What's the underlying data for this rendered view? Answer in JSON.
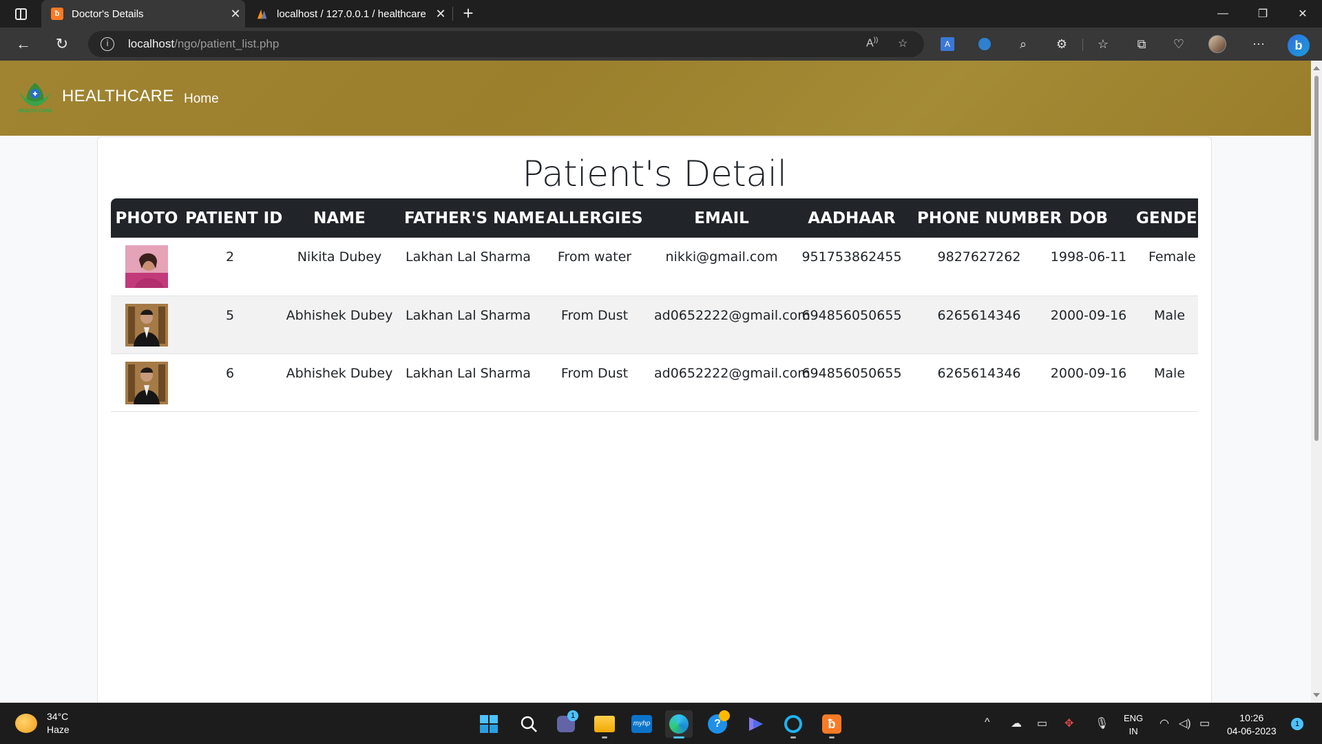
{
  "browser": {
    "tabs": [
      {
        "title": "Doctor's Details",
        "active": true
      },
      {
        "title": "localhost / 127.0.0.1 / healthcare",
        "active": false
      }
    ],
    "url_host": "localhost",
    "url_path": "/ngo/patient_list.php"
  },
  "site": {
    "brand": "HEALTHCARE",
    "logo_text": "HEALTH CARE",
    "nav_home": "Home",
    "page_title": "Patient's Detail"
  },
  "table": {
    "headers": [
      "PHOTO",
      "PATIENT ID",
      "NAME",
      "FATHER'S NAME",
      "ALLERGIES",
      "EMAIL",
      "AADHAAR",
      "PHONE NUMBER",
      "DOB",
      "GENDER"
    ],
    "rows": [
      {
        "photo": "female-portrait",
        "id": "2",
        "name": "Nikita Dubey",
        "father": "Lakhan Lal Sharma",
        "allergies": "From water",
        "email": "nikki@gmail.com",
        "aadhaar": "951753862455",
        "phone": "9827627262",
        "dob": "1998-06-11",
        "gender": "Female"
      },
      {
        "photo": "male-portrait",
        "id": "5",
        "name": "Abhishek Dubey",
        "father": "Lakhan Lal Sharma",
        "allergies": "From Dust",
        "email": "ad0652222@gmail.com",
        "aadhaar": "694856050655",
        "phone": "6265614346",
        "dob": "2000-09-16",
        "gender": "Male"
      },
      {
        "photo": "male-portrait",
        "id": "6",
        "name": "Abhishek Dubey",
        "father": "Lakhan Lal Sharma",
        "allergies": "From Dust",
        "email": "ad0652222@gmail.com",
        "aadhaar": "694856050655",
        "phone": "6265614346",
        "dob": "2000-09-16",
        "gender": "Male"
      }
    ]
  },
  "taskbar": {
    "weather_temp": "34°C",
    "weather_desc": "Haze",
    "teams_badge": "1",
    "lang_line1": "ENG",
    "lang_line2": "IN",
    "time": "10:26",
    "date": "04-06-2023",
    "notification_count": "1"
  },
  "colors": {
    "navbar": "#a08432",
    "table_header": "#212529",
    "accent": "#4cc2ff"
  }
}
